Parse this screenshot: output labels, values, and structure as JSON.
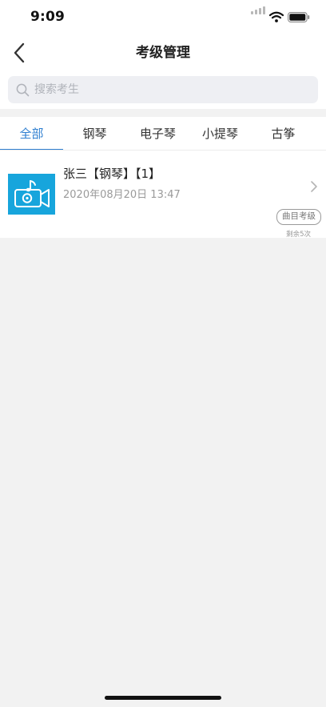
{
  "status_bar": {
    "time": "9:09",
    "icons": [
      "signal-icon",
      "wifi-icon",
      "battery-icon"
    ]
  },
  "nav": {
    "title": "考级管理",
    "back_icon": "chevron-left-icon"
  },
  "search": {
    "placeholder": "搜索考生",
    "value": "",
    "icon": "search-icon"
  },
  "tabs": [
    {
      "label": "全部",
      "active": true
    },
    {
      "label": "钢琴",
      "active": false
    },
    {
      "label": "电子琴",
      "active": false
    },
    {
      "label": "小提琴",
      "active": false
    },
    {
      "label": "古筝",
      "active": false
    }
  ],
  "list": {
    "items": [
      {
        "title": "张三【钢琴】【1】",
        "date": "2020年08月20日 13:47",
        "badge": "曲目考级",
        "remaining": "剩余5次",
        "thumbnail_icon": "video-camera-music-icon"
      }
    ]
  },
  "colors": {
    "accent": "#2f7fd0",
    "thumbnail_bg": "#17a5dc",
    "page_bg": "#f2f2f2",
    "search_bg": "#eeeff3"
  }
}
